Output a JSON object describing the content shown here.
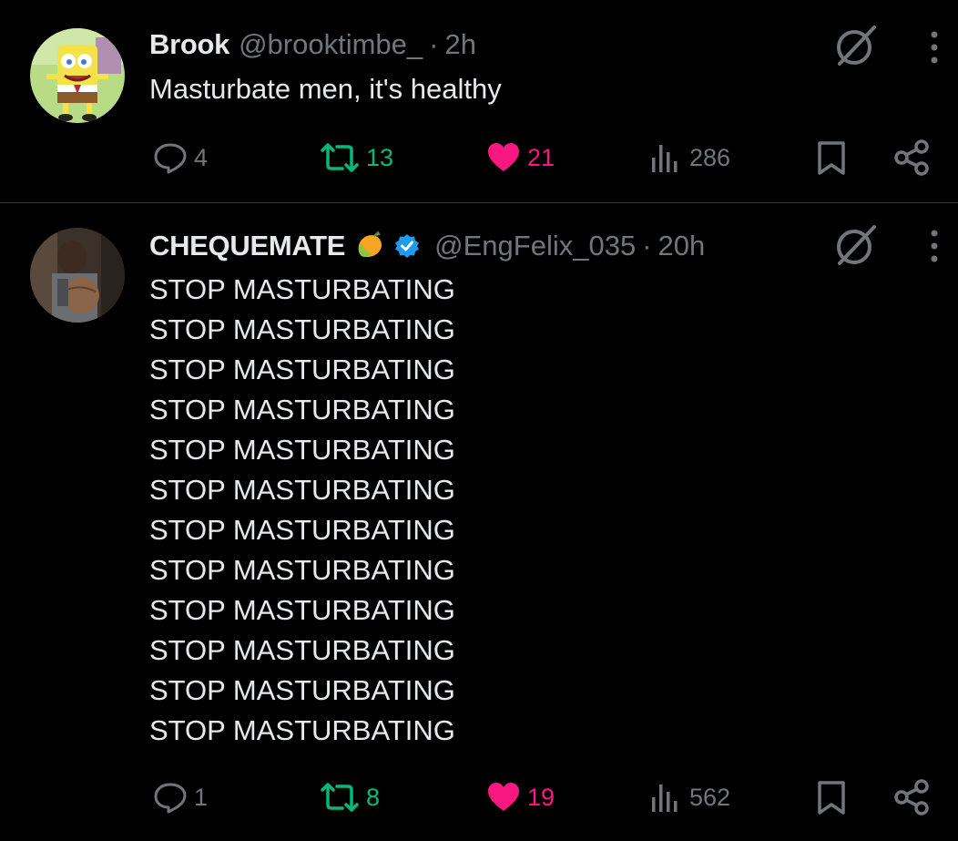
{
  "tweets": [
    {
      "author": "Brook",
      "handle": "@brooktimbe_",
      "separator": "·",
      "time": "2h",
      "avatar_icon": "spongebob-avatar",
      "lines": [
        "Masturbate men, it's healthy"
      ],
      "stats": {
        "replies": "4",
        "retweets": "13",
        "likes": "21",
        "views": "286"
      }
    },
    {
      "author": "CHEQUEMATE",
      "author_emoji": "mango-emoji",
      "verified": true,
      "handle": "@EngFelix_035",
      "separator": "·",
      "time": "20h",
      "avatar_icon": "boy-holding-ball-avatar",
      "lines": [
        "STOP MASTURBATING",
        "STOP MASTURBATING",
        "STOP MASTURBATING",
        "STOP MASTURBATING",
        "STOP MASTURBATING",
        "STOP MASTURBATING",
        "STOP MASTURBATING",
        "STOP MASTURBATING",
        "STOP MASTURBATING",
        "STOP MASTURBATING",
        "STOP MASTURBATING",
        "STOP MASTURBATING"
      ],
      "stats": {
        "replies": "1",
        "retweets": "8",
        "likes": "19",
        "views": "562"
      }
    }
  ],
  "colors": {
    "background": "#000000",
    "text": "#e7e9ea",
    "muted": "#71767b",
    "retweet": "#00ba7c",
    "like": "#f91880",
    "verified": "#1d9bf0",
    "divider": "#2f3336"
  },
  "icons": [
    "reply-icon",
    "retweet-icon",
    "like-icon",
    "views-icon",
    "bookmark-icon",
    "share-icon",
    "grok-icon",
    "more-icon",
    "verified-icon"
  ]
}
